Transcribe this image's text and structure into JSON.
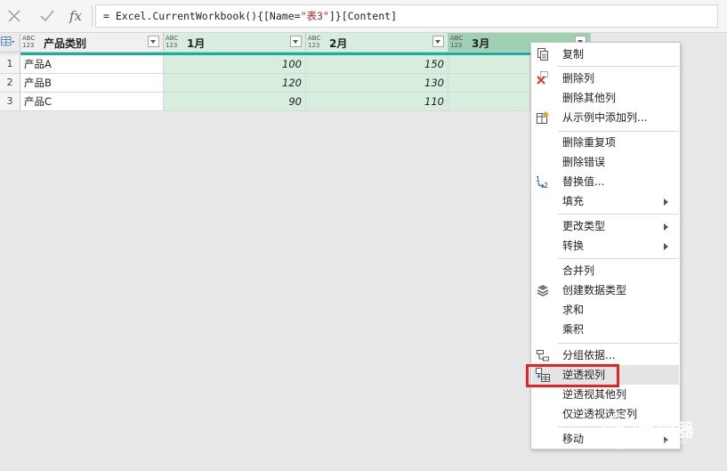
{
  "formula_bar": {
    "formula_prefix": "= Excel.CurrentWorkbook(){[Name=",
    "formula_string": "\"表3\"",
    "formula_suffix": "]}[Content]",
    "fx_label": "fx"
  },
  "table": {
    "columns": [
      {
        "name": "产品类别",
        "type": "ABC 123"
      },
      {
        "name": "1月",
        "type": "ABC 123"
      },
      {
        "name": "2月",
        "type": "ABC 123"
      },
      {
        "name": "3月",
        "type": "ABC 123"
      }
    ],
    "rows": [
      {
        "num": "1",
        "category": "产品A",
        "m1": "100",
        "m2": "150"
      },
      {
        "num": "2",
        "category": "产品B",
        "m1": "120",
        "m2": "130"
      },
      {
        "num": "3",
        "category": "产品C",
        "m1": "90",
        "m2": "110"
      }
    ]
  },
  "context_menu": {
    "items": [
      {
        "label": "复制",
        "icon": "copy-icon"
      },
      {
        "label": "删除列",
        "icon": "delete-icon"
      },
      {
        "label": "删除其他列"
      },
      {
        "label": "从示例中添加列...",
        "icon": "column-from-example-icon"
      },
      {
        "label": "删除重复项"
      },
      {
        "label": "删除错误"
      },
      {
        "label": "替换值...",
        "icon": "replace-values-icon"
      },
      {
        "label": "填充",
        "submenu": true
      },
      {
        "label": "更改类型",
        "submenu": true
      },
      {
        "label": "转换",
        "submenu": true
      },
      {
        "label": "合并列"
      },
      {
        "label": "创建数据类型",
        "icon": "data-type-icon"
      },
      {
        "label": "求和"
      },
      {
        "label": "乘积"
      },
      {
        "label": "分组依据...",
        "icon": "group-by-icon"
      },
      {
        "label": "逆透视列",
        "icon": "unpivot-icon"
      },
      {
        "label": "逆透视其他列"
      },
      {
        "label": "仅逆透视选定列"
      },
      {
        "label": "移动",
        "submenu": true
      }
    ],
    "highlighted_item": "逆透视列"
  },
  "watermark": {
    "text": "路由器",
    "sub": "luyouqi.com"
  },
  "colors": {
    "accent_green": "#13b29a",
    "column_green": "#d7eedf",
    "selected_header": "#9fd0b1",
    "highlight_box": "#e52320"
  }
}
